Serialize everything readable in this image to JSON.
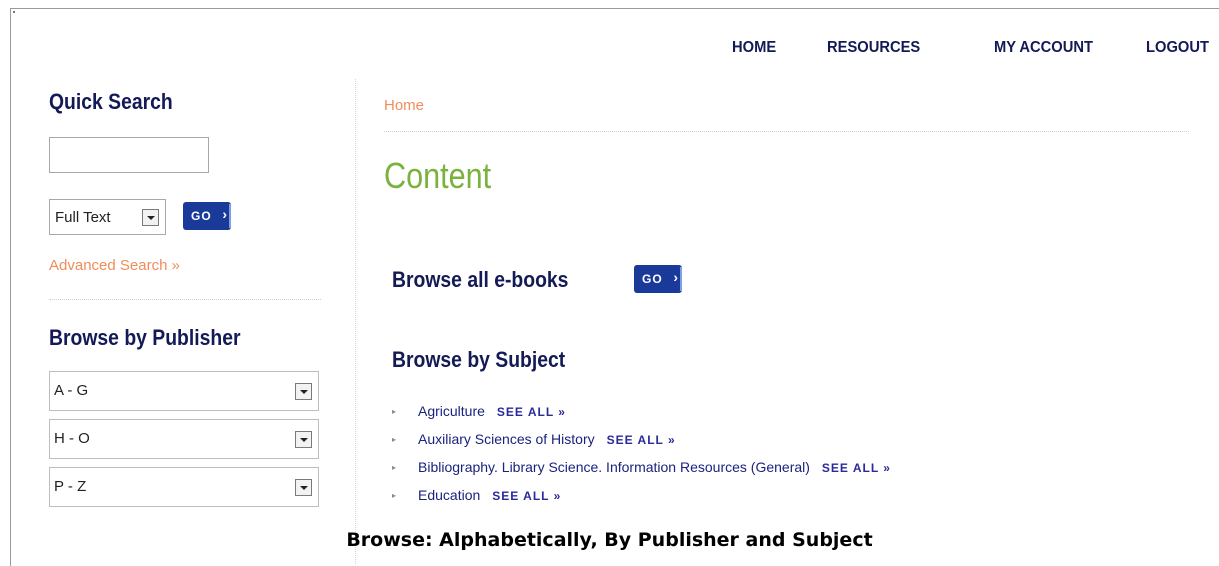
{
  "nav": {
    "items": [
      "HOME",
      "RESOURCES",
      "MY ACCOUNT",
      "LOGOUT"
    ]
  },
  "sidebar": {
    "quick_search_heading": "Quick Search",
    "search_input_value": "",
    "search_type_selected": "Full Text",
    "go_label": "GO",
    "advanced_search_label": "Advanced Search »",
    "browse_publisher_heading": "Browse by Publisher",
    "publisher_ranges": [
      "A - G",
      "H - O",
      "P - Z"
    ]
  },
  "main": {
    "breadcrumb": "Home",
    "page_title": "Content",
    "browse_ebooks_label": "Browse all e-books",
    "go_label": "GO",
    "browse_subject_heading": "Browse by Subject",
    "see_all_label": "SEE ALL »",
    "subjects": [
      "Agriculture",
      "Auxiliary Sciences of History",
      "Bibliography. Library Science. Information Resources (General)",
      "Education"
    ]
  },
  "caption": "Browse: Alphabetically, By Publisher and Subject"
}
